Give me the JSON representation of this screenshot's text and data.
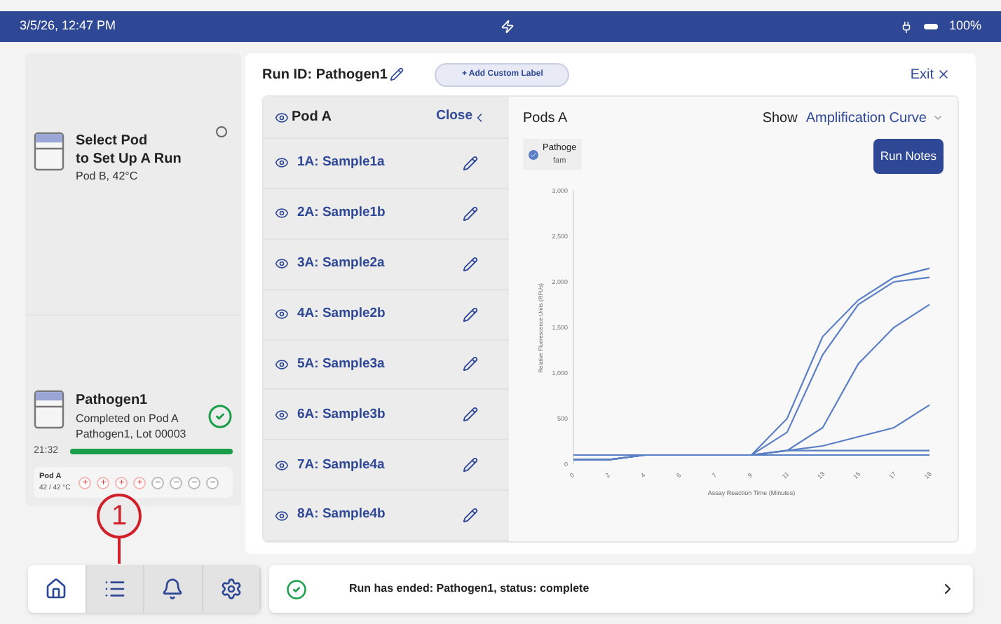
{
  "status_bar": {
    "datetime": "3/5/26, 12:47 PM",
    "battery": "100%"
  },
  "pods": [
    {
      "kind": "idle",
      "title": "Select Pod\nto Set Up A Run",
      "subtitle": "Pod B, 42°C",
      "selected": false
    },
    {
      "kind": "run",
      "title": "Pathogen1",
      "lines": [
        "Completed on Pod A",
        "Pathogen1, Lot 00003"
      ],
      "time": "21:32",
      "level": 1,
      "complete": true,
      "slots_label": "Pod A",
      "slots_temp": "42 / 42 °C",
      "slots": [
        {
          "kind": "positive",
          "symbol": "+"
        },
        {
          "kind": "positive",
          "symbol": "+"
        },
        {
          "kind": "positive",
          "symbol": "+"
        },
        {
          "kind": "positive",
          "symbol": "+"
        },
        {
          "kind": "negative",
          "symbol": "−"
        },
        {
          "kind": "negative",
          "symbol": "−"
        },
        {
          "kind": "negative",
          "symbol": "−"
        },
        {
          "kind": "negative",
          "symbol": "−"
        }
      ]
    }
  ],
  "callout": "1",
  "header": {
    "run_id": "Run ID: Pathogen1",
    "add_label": "+ Add Custom Label",
    "exit": "Exit"
  },
  "sample_panel": {
    "title": "Pod A",
    "close": "Close"
  },
  "samples": [
    "1A: Sample1a",
    "2A: Sample1b",
    "3A: Sample2a",
    "4A: Sample2b",
    "5A: Sample3a",
    "6A: Sample3b",
    "7A: Sample4a",
    "8A: Sample4b"
  ],
  "chart_panel": {
    "title": "Pods A",
    "show_label": "Show",
    "show_value": "Amplification Curve",
    "run_notes": "Run Notes",
    "legend": {
      "name": "Pathoge",
      "dye": "fam",
      "checked": true
    }
  },
  "chart_data": {
    "type": "line",
    "xlabel": "Assay Reaction Time (Minutes)",
    "ylabel": "Relative Fluorescence Units (RFUs)",
    "categories": [
      "0",
      "2",
      "4",
      "6",
      "7",
      "9",
      "11",
      "13",
      "15",
      "17",
      "18"
    ],
    "ylim": [
      0,
      3000
    ],
    "yticks": [
      {
        "value": 0,
        "label": "0"
      },
      {
        "value": 500,
        "label": "500"
      },
      {
        "value": 1000,
        "label": "1,000"
      },
      {
        "value": 1500,
        "label": "1,500"
      },
      {
        "value": 2000,
        "label": "2,000"
      },
      {
        "value": 2500,
        "label": "2,500"
      },
      {
        "value": 3000,
        "label": "3,000"
      }
    ],
    "series": [
      {
        "color": "#5b7fc4",
        "values": [
          50,
          50,
          100,
          100,
          100,
          100,
          500,
          1400,
          1800,
          2050,
          2150
        ]
      },
      {
        "color": "#5b7fc4",
        "values": [
          50,
          50,
          100,
          100,
          100,
          100,
          350,
          1200,
          1750,
          2000,
          2050
        ]
      },
      {
        "color": "#5b7fc4",
        "values": [
          50,
          50,
          100,
          100,
          100,
          100,
          150,
          400,
          1100,
          1500,
          1750
        ]
      },
      {
        "color": "#5b7fc4",
        "values": [
          50,
          50,
          100,
          100,
          100,
          100,
          150,
          200,
          300,
          400,
          650
        ]
      },
      {
        "color": "#5b7fc4",
        "values": [
          100,
          100,
          100,
          100,
          100,
          100,
          150,
          150,
          150,
          150,
          150
        ]
      },
      {
        "color": "#5b7fc4",
        "values": [
          50,
          50,
          100,
          100,
          100,
          100,
          100,
          100,
          100,
          100,
          100
        ]
      }
    ]
  },
  "nav": [
    {
      "kind": "home",
      "selected": true
    },
    {
      "kind": "list",
      "selected": false
    },
    {
      "kind": "bell",
      "selected": false
    },
    {
      "kind": "gear",
      "selected": false
    }
  ],
  "message": "Run has ended: Pathogen1, status: complete"
}
